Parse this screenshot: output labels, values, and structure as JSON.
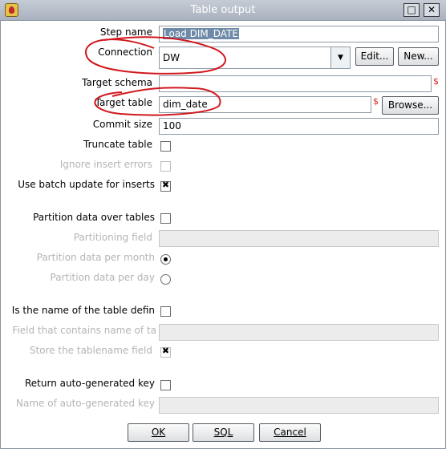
{
  "window": {
    "title": "Table output",
    "maximize_glyph": "□",
    "close_glyph": "✕",
    "icon": "app-icon"
  },
  "form": {
    "step_name": {
      "label": "Step name",
      "value": "Load DIM_DATE"
    },
    "connection": {
      "label": "Connection",
      "value": "DW",
      "edit_button": "Edit...",
      "new_button": "New..."
    },
    "target_schema": {
      "label": "Target schema",
      "value": "",
      "var_marker": "$"
    },
    "target_table": {
      "label": "Target table",
      "value": "dim_date",
      "var_marker": "$",
      "browse_button": "Browse..."
    },
    "commit_size": {
      "label": "Commit size",
      "value": "100"
    },
    "truncate_table": {
      "label": "Truncate table",
      "checked": false
    },
    "ignore_insert_errors": {
      "label": "Ignore insert errors",
      "checked": false,
      "enabled": false
    },
    "batch_update": {
      "label": "Use batch update for inserts",
      "checked": true
    },
    "partition_data": {
      "label": "Partition data over tables",
      "checked": false
    },
    "partitioning_field": {
      "label": "Partitioning field",
      "value": "",
      "enabled": false
    },
    "partition_per_month": {
      "label": "Partition data per month",
      "selected": true,
      "enabled": false
    },
    "partition_per_day": {
      "label": "Partition data per day",
      "selected": false,
      "enabled": false
    },
    "name_in_field": {
      "label": "Is the name of the table defin",
      "checked": false
    },
    "field_table_name": {
      "label": "Field that contains name of ta",
      "value": "",
      "enabled": false
    },
    "store_tablename": {
      "label": "Store the tablename field",
      "checked": true,
      "enabled": false
    },
    "return_autogen_key": {
      "label": "Return auto-generated key",
      "checked": false
    },
    "autogen_key_name": {
      "label": "Name of auto-generated key",
      "value": "",
      "enabled": false
    }
  },
  "buttons": {
    "ok": "OK",
    "sql": "SQL",
    "cancel": "Cancel"
  },
  "annotation_color": "#d0191f"
}
